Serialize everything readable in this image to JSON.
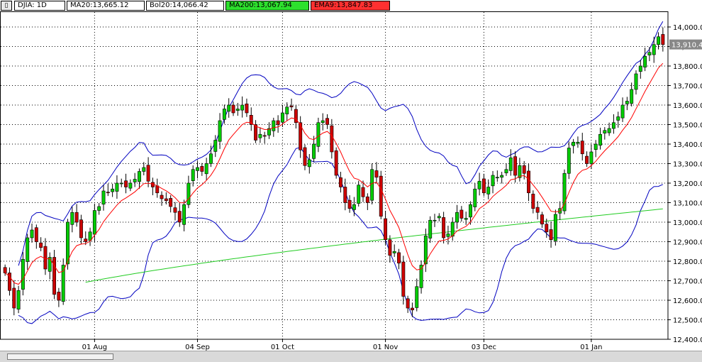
{
  "header": {
    "menu_icon": "menu-icon",
    "symbol": "DJIA: 1D",
    "ma20": "MA20:13,665.12",
    "bol20": "Bol20:14,066.42",
    "ma200": "MA200:13,067.94",
    "ema9": "EMA9:13,847.83"
  },
  "colors": {
    "ma200_bg": "#2de02d",
    "ema9_bg": "#ff3030",
    "up_candle": "#00cc00",
    "down_candle": "#cc0000",
    "bollinger": "#0000c0",
    "ema_line": "#ff0000",
    "ma200_line": "#22cc22",
    "last_price_tag": "#888888"
  },
  "chart_data": {
    "type": "candlestick",
    "symbol": "DJIA",
    "interval": "1D",
    "ylim": [
      12400,
      14080
    ],
    "grid": true,
    "y_axis_position": "right",
    "y_ticks": [
      "14,000.0",
      "13,900.0",
      "13,800.0",
      "13,700.0",
      "13,600.0",
      "13,500.0",
      "13,400.0",
      "13,300.0",
      "13,200.0",
      "13,100.0",
      "13,000.0",
      "12,900.0",
      "12,800.0",
      "12,700.0",
      "12,600.0",
      "12,500.0",
      "12,400.0"
    ],
    "x_ticks": [
      {
        "label": "01 Aug",
        "bar": 20
      },
      {
        "label": "04 Sep",
        "bar": 43
      },
      {
        "label": "01 Oct",
        "bar": 62
      },
      {
        "label": "01 Nov",
        "bar": 85
      },
      {
        "label": "03 Dec",
        "bar": 107
      },
      {
        "label": "01 Jan",
        "bar": 131
      }
    ],
    "last_price": "13,910.4",
    "closes": [
      12740,
      12650,
      12560,
      12650,
      12810,
      12920,
      12960,
      12900,
      12870,
      12760,
      12820,
      12630,
      12600,
      12780,
      13000,
      13050,
      13000,
      12920,
      12900,
      12950,
      13060,
      13080,
      13160,
      13150,
      13170,
      13200,
      13200,
      13180,
      13200,
      13220,
      13260,
      13280,
      13210,
      13180,
      13150,
      13120,
      13110,
      13080,
      13050,
      13000,
      13090,
      13200,
      13270,
      13280,
      13260,
      13300,
      13350,
      13420,
      13520,
      13580,
      13600,
      13560,
      13580,
      13600,
      13560,
      13500,
      13420,
      13450,
      13440,
      13480,
      13520,
      13500,
      13560,
      13590,
      13590,
      13510,
      13370,
      13290,
      13320,
      13400,
      13510,
      13520,
      13500,
      13360,
      13240,
      13180,
      13100,
      13070,
      13090,
      13190,
      13130,
      13100,
      13270,
      13230,
      13030,
      12910,
      12830,
      12850,
      12790,
      12620,
      12560,
      12550,
      12670,
      12780,
      12930,
      13010,
      13010,
      13030,
      12920,
      12940,
      13000,
      13050,
      13020,
      13020,
      13090,
      13170,
      13210,
      13150,
      13180,
      13240,
      13230,
      13240,
      13270,
      13330,
      13240,
      13290,
      13250,
      13150,
      13070,
      13050,
      12990,
      12950,
      12910,
      13040,
      13070,
      13250,
      13380,
      13410,
      13410,
      13350,
      13300,
      13360,
      13400,
      13450,
      13470,
      13480,
      13510,
      13540,
      13600,
      13620,
      13680,
      13760,
      13800,
      13850,
      13870,
      13910,
      13950,
      13910
    ]
  }
}
